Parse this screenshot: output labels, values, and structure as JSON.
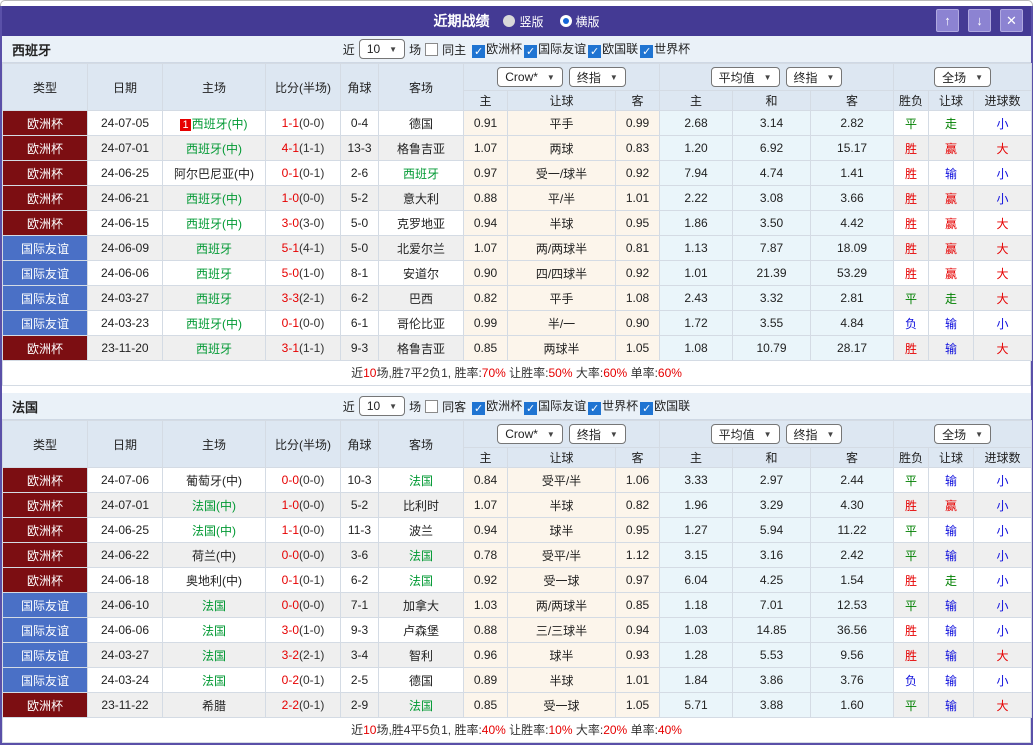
{
  "topbar": {
    "title": "近期战绩",
    "radios": [
      {
        "label": "竖版",
        "selected": false
      },
      {
        "label": "横版",
        "selected": true
      }
    ],
    "buttons": [
      {
        "name": "move-up-button",
        "glyph": "↑"
      },
      {
        "name": "move-down-button",
        "glyph": "↓"
      },
      {
        "name": "close-button",
        "glyph": "✕"
      }
    ]
  },
  "colors": {
    "title_bar": "#443a94",
    "euro_league": "#7c0e12",
    "friendly_league": "#4a70c6",
    "win_red": "#e60000",
    "draw_green": "#008000",
    "lose_blue": "#1010dd",
    "team_green": "#009933",
    "odds_col_bg": "#fcf5eb",
    "avg_col_bg": "#eaf5fa"
  },
  "table_header": {
    "cols": [
      "类型",
      "日期",
      "主场",
      "比分(半场)",
      "角球",
      "客场"
    ],
    "groups": [
      {
        "selects": [
          "Crow*",
          "终指"
        ],
        "subs": [
          "主",
          "让球",
          "客"
        ]
      },
      {
        "selects": [
          "平均值",
          "终指"
        ],
        "subs": [
          "主",
          "和",
          "客"
        ]
      },
      {
        "selects": [
          "全场"
        ],
        "subs": [
          "胜负",
          "让球",
          "进球数"
        ]
      }
    ]
  },
  "sections": [
    {
      "name": "西班牙",
      "filter": {
        "recent_label": "近",
        "count": "10",
        "games_label": "场",
        "same_label": "同主",
        "same_checked": false,
        "leagues": [
          "欧洲杯",
          "国际友谊",
          "欧国联",
          "世界杯"
        ]
      },
      "rows": [
        {
          "league": "欧洲杯",
          "league_type": "euro",
          "date": "24-07-05",
          "home": "西班牙(中)",
          "home_c": "g",
          "home_badge": "1",
          "score": "1-1",
          "half": "(0-0)",
          "corners": "0-4",
          "away": "德国",
          "away_c": "k",
          "crow": [
            "0.91",
            "平手",
            "0.99"
          ],
          "avg": [
            "2.68",
            "3.14",
            "2.82"
          ],
          "results": [
            [
              "平",
              "g"
            ],
            [
              "走",
              "g"
            ],
            [
              "小",
              "b"
            ]
          ]
        },
        {
          "league": "欧洲杯",
          "league_type": "euro",
          "date": "24-07-01",
          "home": "西班牙(中)",
          "home_c": "g",
          "home_badge": "",
          "score": "4-1",
          "half": "(1-1)",
          "corners": "13-3",
          "away": "格鲁吉亚",
          "away_c": "k",
          "crow": [
            "1.07",
            "两球",
            "0.83"
          ],
          "avg": [
            "1.20",
            "6.92",
            "15.17"
          ],
          "results": [
            [
              "胜",
              "r"
            ],
            [
              "赢",
              "r"
            ],
            [
              "大",
              "r"
            ]
          ]
        },
        {
          "league": "欧洲杯",
          "league_type": "euro",
          "date": "24-06-25",
          "home": "阿尔巴尼亚(中)",
          "home_c": "k",
          "home_badge": "",
          "score": "0-1",
          "half": "(0-1)",
          "corners": "2-6",
          "away": "西班牙",
          "away_c": "g",
          "crow": [
            "0.97",
            "受一/球半",
            "0.92"
          ],
          "avg": [
            "7.94",
            "4.74",
            "1.41"
          ],
          "results": [
            [
              "胜",
              "r"
            ],
            [
              "输",
              "b"
            ],
            [
              "小",
              "b"
            ]
          ]
        },
        {
          "league": "欧洲杯",
          "league_type": "euro",
          "date": "24-06-21",
          "home": "西班牙(中)",
          "home_c": "g",
          "home_badge": "",
          "score": "1-0",
          "half": "(0-0)",
          "corners": "5-2",
          "away": "意大利",
          "away_c": "k",
          "crow": [
            "0.88",
            "平/半",
            "1.01"
          ],
          "avg": [
            "2.22",
            "3.08",
            "3.66"
          ],
          "results": [
            [
              "胜",
              "r"
            ],
            [
              "赢",
              "r"
            ],
            [
              "小",
              "b"
            ]
          ]
        },
        {
          "league": "欧洲杯",
          "league_type": "euro",
          "date": "24-06-15",
          "home": "西班牙(中)",
          "home_c": "g",
          "home_badge": "",
          "score": "3-0",
          "half": "(3-0)",
          "corners": "5-0",
          "away": "克罗地亚",
          "away_c": "k",
          "crow": [
            "0.94",
            "半球",
            "0.95"
          ],
          "avg": [
            "1.86",
            "3.50",
            "4.42"
          ],
          "results": [
            [
              "胜",
              "r"
            ],
            [
              "赢",
              "r"
            ],
            [
              "大",
              "r"
            ]
          ]
        },
        {
          "league": "国际友谊",
          "league_type": "friendly",
          "date": "24-06-09",
          "home": "西班牙",
          "home_c": "g",
          "home_badge": "",
          "score": "5-1",
          "half": "(4-1)",
          "corners": "5-0",
          "away": "北爱尔兰",
          "away_c": "k",
          "crow": [
            "1.07",
            "两/两球半",
            "0.81"
          ],
          "avg": [
            "1.13",
            "7.87",
            "18.09"
          ],
          "results": [
            [
              "胜",
              "r"
            ],
            [
              "赢",
              "r"
            ],
            [
              "大",
              "r"
            ]
          ]
        },
        {
          "league": "国际友谊",
          "league_type": "friendly",
          "date": "24-06-06",
          "home": "西班牙",
          "home_c": "g",
          "home_badge": "",
          "score": "5-0",
          "half": "(1-0)",
          "corners": "8-1",
          "away": "安道尔",
          "away_c": "k",
          "crow": [
            "0.90",
            "四/四球半",
            "0.92"
          ],
          "avg": [
            "1.01",
            "21.39",
            "53.29"
          ],
          "results": [
            [
              "胜",
              "r"
            ],
            [
              "赢",
              "r"
            ],
            [
              "大",
              "r"
            ]
          ]
        },
        {
          "league": "国际友谊",
          "league_type": "friendly",
          "date": "24-03-27",
          "home": "西班牙",
          "home_c": "g",
          "home_badge": "",
          "score": "3-3",
          "half": "(2-1)",
          "corners": "6-2",
          "away": "巴西",
          "away_c": "k",
          "crow": [
            "0.82",
            "平手",
            "1.08"
          ],
          "avg": [
            "2.43",
            "3.32",
            "2.81"
          ],
          "results": [
            [
              "平",
              "g"
            ],
            [
              "走",
              "g"
            ],
            [
              "大",
              "r"
            ]
          ]
        },
        {
          "league": "国际友谊",
          "league_type": "friendly",
          "date": "24-03-23",
          "home": "西班牙(中)",
          "home_c": "g",
          "home_badge": "",
          "score": "0-1",
          "half": "(0-0)",
          "corners": "6-1",
          "away": "哥伦比亚",
          "away_c": "k",
          "crow": [
            "0.99",
            "半/一",
            "0.90"
          ],
          "avg": [
            "1.72",
            "3.55",
            "4.84"
          ],
          "results": [
            [
              "负",
              "b"
            ],
            [
              "输",
              "b"
            ],
            [
              "小",
              "b"
            ]
          ]
        },
        {
          "league": "欧洲杯",
          "league_type": "euro",
          "date": "23-11-20",
          "home": "西班牙",
          "home_c": "g",
          "home_badge": "",
          "score": "3-1",
          "half": "(1-1)",
          "corners": "9-3",
          "away": "格鲁吉亚",
          "away_c": "k",
          "crow": [
            "0.85",
            "两球半",
            "1.05"
          ],
          "avg": [
            "1.08",
            "10.79",
            "28.17"
          ],
          "results": [
            [
              "胜",
              "r"
            ],
            [
              "输",
              "b"
            ],
            [
              "大",
              "r"
            ]
          ]
        }
      ],
      "footer": [
        [
          "近",
          "k"
        ],
        [
          "10",
          "r"
        ],
        [
          "场,胜7平2负1, 胜率:",
          "k"
        ],
        [
          "70%",
          "r"
        ],
        [
          " 让胜率:",
          "k"
        ],
        [
          "50%",
          "r"
        ],
        [
          " 大率:",
          "k"
        ],
        [
          "60%",
          "r"
        ],
        [
          " 单率:",
          "k"
        ],
        [
          "60%",
          "r"
        ]
      ]
    },
    {
      "name": "法国",
      "filter": {
        "recent_label": "近",
        "count": "10",
        "games_label": "场",
        "same_label": "同客",
        "same_checked": false,
        "leagues": [
          "欧洲杯",
          "国际友谊",
          "世界杯",
          "欧国联"
        ]
      },
      "rows": [
        {
          "league": "欧洲杯",
          "league_type": "euro",
          "date": "24-07-06",
          "home": "葡萄牙(中)",
          "home_c": "k",
          "home_badge": "",
          "score": "0-0",
          "half": "(0-0)",
          "corners": "10-3",
          "away": "法国",
          "away_c": "g",
          "crow": [
            "0.84",
            "受平/半",
            "1.06"
          ],
          "avg": [
            "3.33",
            "2.97",
            "2.44"
          ],
          "results": [
            [
              "平",
              "g"
            ],
            [
              "输",
              "b"
            ],
            [
              "小",
              "b"
            ]
          ]
        },
        {
          "league": "欧洲杯",
          "league_type": "euro",
          "date": "24-07-01",
          "home": "法国(中)",
          "home_c": "g",
          "home_badge": "",
          "score": "1-0",
          "half": "(0-0)",
          "corners": "5-2",
          "away": "比利时",
          "away_c": "k",
          "crow": [
            "1.07",
            "半球",
            "0.82"
          ],
          "avg": [
            "1.96",
            "3.29",
            "4.30"
          ],
          "results": [
            [
              "胜",
              "r"
            ],
            [
              "赢",
              "r"
            ],
            [
              "小",
              "b"
            ]
          ]
        },
        {
          "league": "欧洲杯",
          "league_type": "euro",
          "date": "24-06-25",
          "home": "法国(中)",
          "home_c": "g",
          "home_badge": "",
          "score": "1-1",
          "half": "(0-0)",
          "corners": "11-3",
          "away": "波兰",
          "away_c": "k",
          "crow": [
            "0.94",
            "球半",
            "0.95"
          ],
          "avg": [
            "1.27",
            "5.94",
            "11.22"
          ],
          "results": [
            [
              "平",
              "g"
            ],
            [
              "输",
              "b"
            ],
            [
              "小",
              "b"
            ]
          ]
        },
        {
          "league": "欧洲杯",
          "league_type": "euro",
          "date": "24-06-22",
          "home": "荷兰(中)",
          "home_c": "k",
          "home_badge": "",
          "score": "0-0",
          "half": "(0-0)",
          "corners": "3-6",
          "away": "法国",
          "away_c": "g",
          "crow": [
            "0.78",
            "受平/半",
            "1.12"
          ],
          "avg": [
            "3.15",
            "3.16",
            "2.42"
          ],
          "results": [
            [
              "平",
              "g"
            ],
            [
              "输",
              "b"
            ],
            [
              "小",
              "b"
            ]
          ]
        },
        {
          "league": "欧洲杯",
          "league_type": "euro",
          "date": "24-06-18",
          "home": "奥地利(中)",
          "home_c": "k",
          "home_badge": "",
          "score": "0-1",
          "half": "(0-1)",
          "corners": "6-2",
          "away": "法国",
          "away_c": "g",
          "crow": [
            "0.92",
            "受一球",
            "0.97"
          ],
          "avg": [
            "6.04",
            "4.25",
            "1.54"
          ],
          "results": [
            [
              "胜",
              "r"
            ],
            [
              "走",
              "g"
            ],
            [
              "小",
              "b"
            ]
          ]
        },
        {
          "league": "国际友谊",
          "league_type": "friendly",
          "date": "24-06-10",
          "home": "法国",
          "home_c": "g",
          "home_badge": "",
          "score": "0-0",
          "half": "(0-0)",
          "corners": "7-1",
          "away": "加拿大",
          "away_c": "k",
          "crow": [
            "1.03",
            "两/两球半",
            "0.85"
          ],
          "avg": [
            "1.18",
            "7.01",
            "12.53"
          ],
          "results": [
            [
              "平",
              "g"
            ],
            [
              "输",
              "b"
            ],
            [
              "小",
              "b"
            ]
          ]
        },
        {
          "league": "国际友谊",
          "league_type": "friendly",
          "date": "24-06-06",
          "home": "法国",
          "home_c": "g",
          "home_badge": "",
          "score": "3-0",
          "half": "(1-0)",
          "corners": "9-3",
          "away": "卢森堡",
          "away_c": "k",
          "crow": [
            "0.88",
            "三/三球半",
            "0.94"
          ],
          "avg": [
            "1.03",
            "14.85",
            "36.56"
          ],
          "results": [
            [
              "胜",
              "r"
            ],
            [
              "输",
              "b"
            ],
            [
              "小",
              "b"
            ]
          ]
        },
        {
          "league": "国际友谊",
          "league_type": "friendly",
          "date": "24-03-27",
          "home": "法国",
          "home_c": "g",
          "home_badge": "",
          "score": "3-2",
          "half": "(2-1)",
          "corners": "3-4",
          "away": "智利",
          "away_c": "k",
          "crow": [
            "0.96",
            "球半",
            "0.93"
          ],
          "avg": [
            "1.28",
            "5.53",
            "9.56"
          ],
          "results": [
            [
              "胜",
              "r"
            ],
            [
              "输",
              "b"
            ],
            [
              "大",
              "r"
            ]
          ]
        },
        {
          "league": "国际友谊",
          "league_type": "friendly",
          "date": "24-03-24",
          "home": "法国",
          "home_c": "g",
          "home_badge": "",
          "score": "0-2",
          "half": "(0-1)",
          "corners": "2-5",
          "away": "德国",
          "away_c": "k",
          "crow": [
            "0.89",
            "半球",
            "1.01"
          ],
          "avg": [
            "1.84",
            "3.86",
            "3.76"
          ],
          "results": [
            [
              "负",
              "b"
            ],
            [
              "输",
              "b"
            ],
            [
              "小",
              "b"
            ]
          ]
        },
        {
          "league": "欧洲杯",
          "league_type": "euro",
          "date": "23-11-22",
          "home": "希腊",
          "home_c": "k",
          "home_badge": "",
          "score": "2-2",
          "half": "(0-1)",
          "corners": "2-9",
          "away": "法国",
          "away_c": "g",
          "crow": [
            "0.85",
            "受一球",
            "1.05"
          ],
          "avg": [
            "5.71",
            "3.88",
            "1.60"
          ],
          "results": [
            [
              "平",
              "g"
            ],
            [
              "输",
              "b"
            ],
            [
              "大",
              "r"
            ]
          ]
        }
      ],
      "footer": [
        [
          "近",
          "k"
        ],
        [
          "10",
          "r"
        ],
        [
          "场,胜4平5负1, 胜率:",
          "k"
        ],
        [
          "40%",
          "r"
        ],
        [
          " 让胜率:",
          "k"
        ],
        [
          "10%",
          "r"
        ],
        [
          " 大率:",
          "k"
        ],
        [
          "20%",
          "r"
        ],
        [
          " 单率:",
          "k"
        ],
        [
          "40%",
          "r"
        ]
      ]
    }
  ]
}
